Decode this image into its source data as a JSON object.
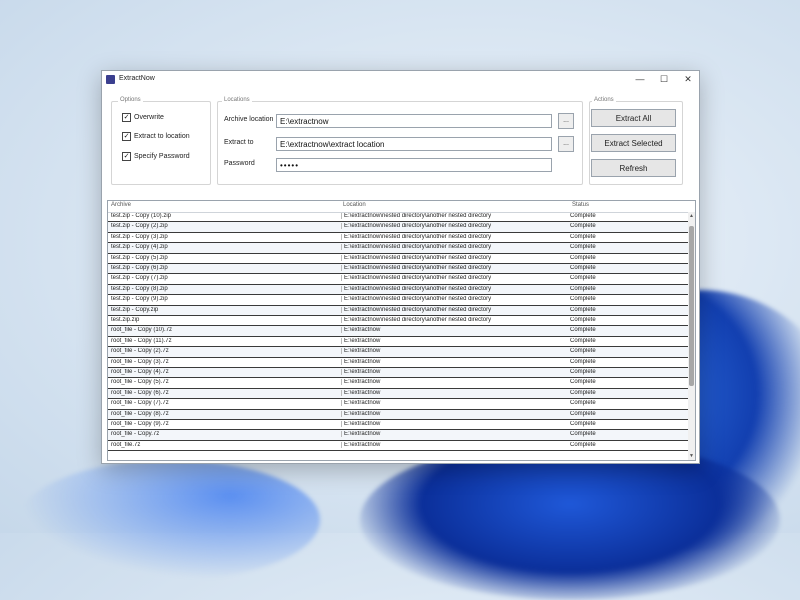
{
  "window": {
    "title": "ExtractNow",
    "controls": {
      "minimize": "—",
      "maximize": "☐",
      "close": "✕"
    }
  },
  "options": {
    "legend": "Options",
    "overwrite": {
      "label": "Overwrite",
      "checked": true
    },
    "extract_to_location": {
      "label": "Extract to location",
      "checked": true
    },
    "specify_password": {
      "label": "Specify Password",
      "checked": true
    }
  },
  "locations": {
    "legend": "Locations",
    "archive_location_label": "Archive location",
    "archive_location_value": "E:\\extractnow",
    "extract_to_label": "Extract to",
    "extract_to_value": "E:\\extractnow\\extract location",
    "password_label": "Password",
    "password_value": "•••••",
    "browse_label": "..."
  },
  "actions": {
    "legend": "Actions",
    "extract_all": "Extract All",
    "extract_selected": "Extract Selected",
    "refresh": "Refresh"
  },
  "table": {
    "columns": [
      "Archive",
      "Location",
      "Status"
    ],
    "rows": [
      [
        "test.zip - Copy (10).zip",
        "E:\\extractnow\\nested directory\\another nested directory",
        "Complete"
      ],
      [
        "test.zip - Copy (2).zip",
        "E:\\extractnow\\nested directory\\another nested directory",
        "Complete"
      ],
      [
        "test.zip - Copy (3).zip",
        "E:\\extractnow\\nested directory\\another nested directory",
        "Complete"
      ],
      [
        "test.zip - Copy (4).zip",
        "E:\\extractnow\\nested directory\\another nested directory",
        "Complete"
      ],
      [
        "test.zip - Copy (5).zip",
        "E:\\extractnow\\nested directory\\another nested directory",
        "Complete"
      ],
      [
        "test.zip - Copy (6).zip",
        "E:\\extractnow\\nested directory\\another nested directory",
        "Complete"
      ],
      [
        "test.zip - Copy (7).zip",
        "E:\\extractnow\\nested directory\\another nested directory",
        "Complete"
      ],
      [
        "test.zip - Copy (8).zip",
        "E:\\extractnow\\nested directory\\another nested directory",
        "Complete"
      ],
      [
        "test.zip - Copy (9).zip",
        "E:\\extractnow\\nested directory\\another nested directory",
        "Complete"
      ],
      [
        "test.zip - Copy.zip",
        "E:\\extractnow\\nested directory\\another nested directory",
        "Complete"
      ],
      [
        "test.zip.zip",
        "E:\\extractnow\\nested directory\\another nested directory",
        "Complete"
      ],
      [
        "root_file - Copy (10).7z",
        "E:\\extractnow",
        "Complete"
      ],
      [
        "root_file - Copy (11).7z",
        "E:\\extractnow",
        "Complete"
      ],
      [
        "root_file - Copy (2).7z",
        "E:\\extractnow",
        "Complete"
      ],
      [
        "root_file - Copy (3).7z",
        "E:\\extractnow",
        "Complete"
      ],
      [
        "root_file - Copy (4).7z",
        "E:\\extractnow",
        "Complete"
      ],
      [
        "root_file - Copy (5).7z",
        "E:\\extractnow",
        "Complete"
      ],
      [
        "root_file - Copy (6).7z",
        "E:\\extractnow",
        "Complete"
      ],
      [
        "root_file - Copy (7).7z",
        "E:\\extractnow",
        "Complete"
      ],
      [
        "root_file - Copy (8).7z",
        "E:\\extractnow",
        "Complete"
      ],
      [
        "root_file - Copy (9).7z",
        "E:\\extractnow",
        "Complete"
      ],
      [
        "root_file - Copy.7z",
        "E:\\extractnow",
        "Complete"
      ],
      [
        "root_file.7z",
        "E:\\extractnow",
        "Complete"
      ]
    ]
  },
  "scrollbar": {
    "up": "▲",
    "down": "▼"
  }
}
